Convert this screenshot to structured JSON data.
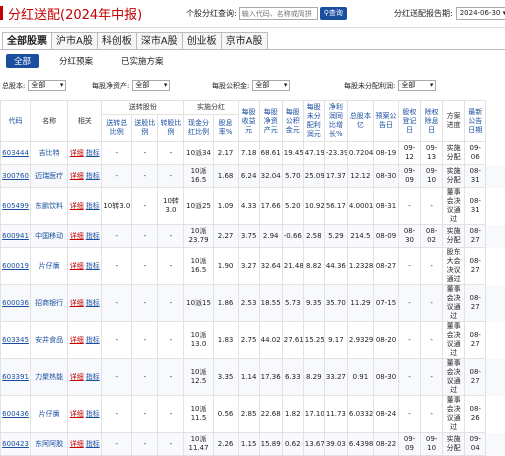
{
  "header": {
    "title": "分红送配(2024年中报)"
  },
  "search": {
    "label": "个股分红查询:",
    "placeholder": "输入代码、名称或简拼",
    "button": "查询"
  },
  "report": {
    "label": "分红送配报告期:",
    "value": "2024-06-30"
  },
  "tabs": [
    "全部股票",
    "沪市A股",
    "科创板",
    "深市A股",
    "创业板",
    "京市A股"
  ],
  "subtabs": [
    "全部",
    "分红预案",
    "已实施方案"
  ],
  "filters": [
    {
      "label": "总股本:",
      "value": "全部"
    },
    {
      "label": "每股净资产:",
      "value": "全部"
    },
    {
      "label": "每股公积金:",
      "value": "全部"
    },
    {
      "label": "每股未分配利润:",
      "value": "全部"
    }
  ],
  "columns": {
    "code": "代码",
    "name": "名称",
    "related": "相关",
    "group_bonus": "送转股份",
    "group_cash": "实施分红",
    "total_ratio": "送转总比例",
    "bonus_ratio": "送股比例",
    "transfer_ratio": "转股比例",
    "cash_ratio": "现金分红比例",
    "yield": "股息率%",
    "eps": "每股收益元",
    "bvps": "每股净资产元",
    "reserve": "每股公积金元",
    "undist": "每股未分配利润元",
    "growth": "净利润同比增长%",
    "shares": "总股本亿",
    "plan_date": "预案公告日",
    "record_date": "股权登记日",
    "ex_date": "除权除息日",
    "progress": "方案进度",
    "latest_date": "最新公告日期"
  },
  "link_labels": {
    "detail": "详细",
    "guide": "指标"
  },
  "rows": [
    {
      "code": "603444",
      "name": "吉比特",
      "total": "-",
      "bonus": "-",
      "transfer": "-",
      "cash": "10派34",
      "yield": "2.17",
      "eps": "7.18",
      "bvps": "68.61",
      "reserve": "19.45",
      "undist": "47.19",
      "growth": "-23.39",
      "shares": "0.7204",
      "plan": "08-19",
      "record": "09-12",
      "ex": "09-13",
      "progress": "实施分配",
      "latest": "09-06"
    },
    {
      "code": "300760",
      "name": "迈瑞医疗",
      "total": "-",
      "bonus": "-",
      "transfer": "-",
      "cash": "10派16.5",
      "yield": "1.68",
      "eps": "6.24",
      "bvps": "32.04",
      "reserve": "5.70",
      "undist": "25.09",
      "growth": "17.37",
      "shares": "12.12",
      "plan": "08-30",
      "record": "09-09",
      "ex": "09-10",
      "progress": "实施分配",
      "latest": "08-31"
    },
    {
      "code": "605499",
      "name": "东鹏饮料",
      "total": "10转3.0",
      "bonus": "-",
      "transfer": "10转3.0",
      "cash": "10派25",
      "yield": "1.09",
      "eps": "4.33",
      "bvps": "17.66",
      "reserve": "5.20",
      "undist": "10.92",
      "growth": "56.17",
      "shares": "4.0001",
      "plan": "08-31",
      "record": "-",
      "ex": "-",
      "progress": "董事会决议通过",
      "latest": "08-31"
    },
    {
      "code": "600941",
      "name": "中国移动",
      "total": "-",
      "bonus": "-",
      "transfer": "-",
      "cash": "10派23.79",
      "yield": "2.27",
      "eps": "3.75",
      "bvps": "2.94",
      "reserve": "-0.66",
      "undist": "2.58",
      "growth": "5.29",
      "shares": "214.5",
      "plan": "08-09",
      "record": "08-30",
      "ex": "08-02",
      "progress": "实施分配",
      "latest": "08-27"
    },
    {
      "code": "600019",
      "name": "片仔癀",
      "total": "-",
      "bonus": "-",
      "transfer": "-",
      "cash": "10派16.5",
      "yield": "1.90",
      "eps": "3.27",
      "bvps": "32.64",
      "reserve": "21.48",
      "undist": "8.82",
      "growth": "44.36",
      "shares": "1.2328",
      "plan": "08-27",
      "record": "-",
      "ex": "-",
      "progress": "股东大会决议通过",
      "latest": "08-27"
    },
    {
      "code": "600036",
      "name": "招商银行",
      "total": "-",
      "bonus": "-",
      "transfer": "-",
      "cash": "10派15",
      "yield": "1.86",
      "eps": "2.53",
      "bvps": "18.55",
      "reserve": "5.73",
      "undist": "9.35",
      "growth": "35.70",
      "shares": "11.29",
      "plan": "07-15",
      "record": "-",
      "ex": "-",
      "progress": "董事会决议通过",
      "latest": "08-27"
    },
    {
      "code": "603345",
      "name": "安井食品",
      "total": "-",
      "bonus": "-",
      "transfer": "-",
      "cash": "10派13.0",
      "yield": "1.83",
      "eps": "2.75",
      "bvps": "44.02",
      "reserve": "27.61",
      "undist": "15.25",
      "growth": "9.17",
      "shares": "2.9329",
      "plan": "08-20",
      "record": "-",
      "ex": "-",
      "progress": "董事会决议通过",
      "latest": "08-27"
    },
    {
      "code": "603391",
      "name": "力聚热能",
      "total": "-",
      "bonus": "-",
      "transfer": "-",
      "cash": "10派12.5",
      "yield": "3.35",
      "eps": "1.14",
      "bvps": "17.36",
      "reserve": "6.33",
      "undist": "8.29",
      "growth": "33.27",
      "shares": "0.91",
      "plan": "08-30",
      "record": "-",
      "ex": "-",
      "progress": "董事会决议通过",
      "latest": "08-27"
    },
    {
      "code": "600436",
      "name": "片仔癀",
      "total": "-",
      "bonus": "-",
      "transfer": "-",
      "cash": "10派11.5",
      "yield": "0.56",
      "eps": "2.85",
      "bvps": "22.68",
      "reserve": "1.82",
      "undist": "17.10",
      "growth": "11.73",
      "shares": "6.0332",
      "plan": "08-24",
      "record": "-",
      "ex": "-",
      "progress": "董事会决议通过",
      "latest": "08-26"
    },
    {
      "code": "600423",
      "name": "东阿阿胶",
      "total": "-",
      "bonus": "-",
      "transfer": "-",
      "cash": "10派11.47",
      "yield": "2.26",
      "eps": "1.15",
      "bvps": "15.89",
      "reserve": "0.62",
      "undist": "13.67",
      "growth": "39.03",
      "shares": "6.4398",
      "plan": "08-22",
      "record": "09-09",
      "ex": "09-10",
      "progress": "实施分配",
      "latest": "09-04"
    }
  ]
}
